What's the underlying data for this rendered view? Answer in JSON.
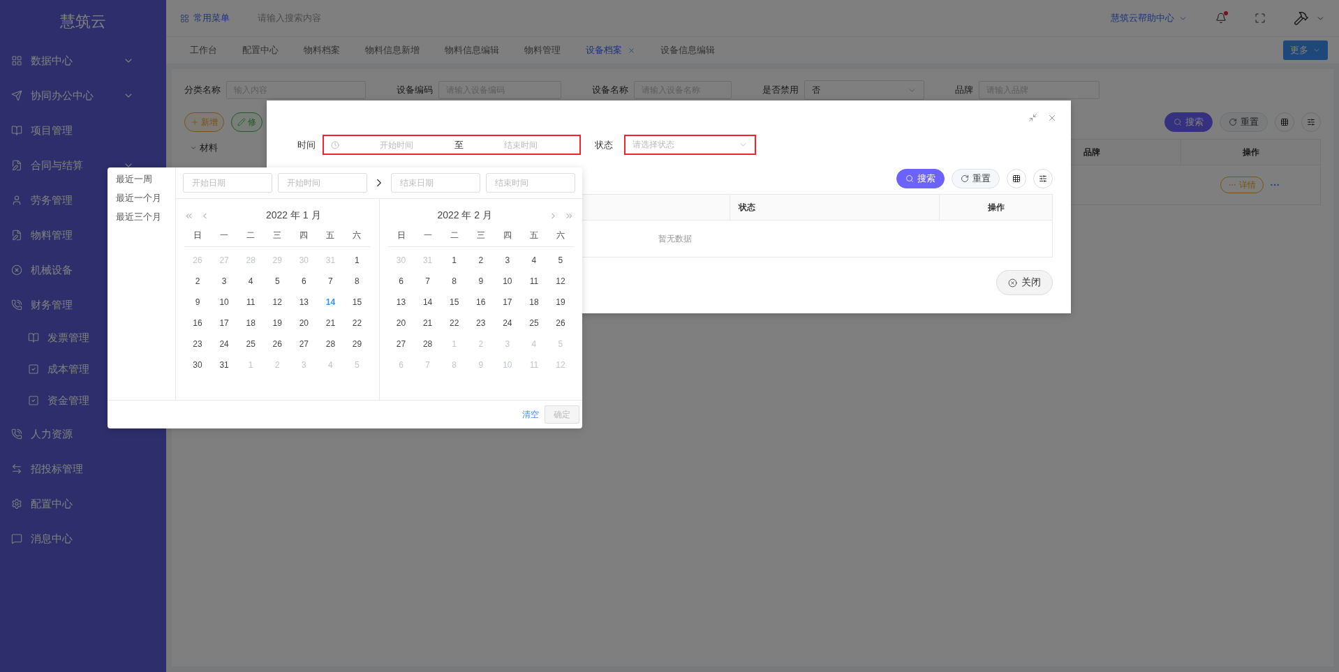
{
  "sidebar": {
    "logo": "慧筑云",
    "items": [
      {
        "label": "数据中心",
        "expanded": false
      },
      {
        "label": "协同办公中心",
        "expanded": false
      },
      {
        "label": "项目管理"
      },
      {
        "label": "合同与结算",
        "expanded": false
      },
      {
        "label": "劳务管理"
      },
      {
        "label": "物料管理"
      },
      {
        "label": "机械设备"
      },
      {
        "label": "财务管理",
        "children": [
          {
            "label": "发票管理"
          },
          {
            "label": "成本管理"
          },
          {
            "label": "资金管理"
          }
        ]
      },
      {
        "label": "人力资源"
      },
      {
        "label": "招投标管理"
      },
      {
        "label": "配置中心"
      },
      {
        "label": "消息中心"
      }
    ]
  },
  "topbar": {
    "menu": "常用菜单",
    "search_placeholder": "请输入搜索内容",
    "help": "慧筑云帮助中心",
    "has_notification": true
  },
  "tabs": [
    {
      "label": "工作台",
      "selected": false
    },
    {
      "label": "配置中心",
      "selected": false
    },
    {
      "label": "物料档案",
      "selected": false
    },
    {
      "label": "物料信息新增",
      "selected": false
    },
    {
      "label": "物料信息编辑",
      "selected": false
    },
    {
      "label": "物料管理",
      "selected": false
    },
    {
      "label": "设备档案",
      "selected": true,
      "closable": true
    },
    {
      "label": "设备信息编辑",
      "selected": false
    }
  ],
  "more_button": "更多",
  "filters": [
    {
      "label": "分类名称",
      "kind": "input",
      "placeholder": "输入内容"
    },
    {
      "label": "设备编码",
      "kind": "input",
      "placeholder": "请输入设备编码"
    },
    {
      "label": "设备名称",
      "kind": "input",
      "placeholder": "请输入设备名称"
    },
    {
      "label": "是否禁用",
      "kind": "select",
      "value": "否"
    },
    {
      "label": "品牌",
      "kind": "input",
      "placeholder": "请输入品牌"
    }
  ],
  "actions": [
    {
      "label": "新增",
      "kind": "add"
    },
    {
      "label": "修",
      "kind": "edit"
    }
  ],
  "tree": [
    {
      "label": "材料",
      "expanded": true
    }
  ],
  "page_toolbar": {
    "search": "搜索",
    "reset": "重置"
  },
  "page_table": {
    "columns": [
      "品牌",
      "操作"
    ],
    "row_action": "详情"
  },
  "dialog": {
    "time": {
      "label": "时间",
      "start_placeholder": "开始时间",
      "separator": "至",
      "end_placeholder": "结束时间",
      "highlighted": true
    },
    "status": {
      "label": "状态",
      "placeholder": "请选择状态",
      "highlighted": true
    },
    "search": "搜索",
    "reset": "重置",
    "columns": [
      "状态",
      "操作"
    ],
    "empty": "暂无数据",
    "close": "关闭"
  },
  "picker": {
    "presets": [
      "最近一周",
      "最近一个月",
      "最近三个月"
    ],
    "start_date_placeholder": "开始日期",
    "start_time_placeholder": "开始时间",
    "end_date_placeholder": "结束日期",
    "end_time_placeholder": "结束时间",
    "months": [
      {
        "title": "2022 年 1 月",
        "weekdays": [
          "日",
          "一",
          "二",
          "三",
          "四",
          "五",
          "六"
        ],
        "weeks": [
          [
            {
              "label": "26",
              "kind": "other"
            },
            {
              "label": "27",
              "kind": "other"
            },
            {
              "label": "28",
              "kind": "other"
            },
            {
              "label": "29",
              "kind": "other"
            },
            {
              "label": "30",
              "kind": "other"
            },
            {
              "label": "31",
              "kind": "other"
            },
            {
              "label": "1",
              "kind": "current"
            }
          ],
          [
            {
              "label": "2",
              "kind": "current"
            },
            {
              "label": "3",
              "kind": "current"
            },
            {
              "label": "4",
              "kind": "current"
            },
            {
              "label": "5",
              "kind": "current"
            },
            {
              "label": "6",
              "kind": "current"
            },
            {
              "label": "7",
              "kind": "current"
            },
            {
              "label": "8",
              "kind": "current"
            }
          ],
          [
            {
              "label": "9",
              "kind": "current"
            },
            {
              "label": "10",
              "kind": "current"
            },
            {
              "label": "11",
              "kind": "current"
            },
            {
              "label": "12",
              "kind": "current"
            },
            {
              "label": "13",
              "kind": "current"
            },
            {
              "label": "14",
              "kind": "today"
            },
            {
              "label": "15",
              "kind": "current"
            }
          ],
          [
            {
              "label": "16",
              "kind": "current"
            },
            {
              "label": "17",
              "kind": "current"
            },
            {
              "label": "18",
              "kind": "current"
            },
            {
              "label": "19",
              "kind": "current"
            },
            {
              "label": "20",
              "kind": "current"
            },
            {
              "label": "21",
              "kind": "current"
            },
            {
              "label": "22",
              "kind": "current"
            }
          ],
          [
            {
              "label": "23",
              "kind": "current"
            },
            {
              "label": "24",
              "kind": "current"
            },
            {
              "label": "25",
              "kind": "current"
            },
            {
              "label": "26",
              "kind": "current"
            },
            {
              "label": "27",
              "kind": "current"
            },
            {
              "label": "28",
              "kind": "current"
            },
            {
              "label": "29",
              "kind": "current"
            }
          ],
          [
            {
              "label": "30",
              "kind": "current"
            },
            {
              "label": "31",
              "kind": "current"
            },
            {
              "label": "1",
              "kind": "other"
            },
            {
              "label": "2",
              "kind": "other"
            },
            {
              "label": "3",
              "kind": "other"
            },
            {
              "label": "4",
              "kind": "other"
            },
            {
              "label": "5",
              "kind": "other"
            }
          ]
        ]
      },
      {
        "title": "2022 年 2 月",
        "weekdays": [
          "日",
          "一",
          "二",
          "三",
          "四",
          "五",
          "六"
        ],
        "weeks": [
          [
            {
              "label": "30",
              "kind": "other"
            },
            {
              "label": "31",
              "kind": "other"
            },
            {
              "label": "1",
              "kind": "current"
            },
            {
              "label": "2",
              "kind": "current"
            },
            {
              "label": "3",
              "kind": "current"
            },
            {
              "label": "4",
              "kind": "current"
            },
            {
              "label": "5",
              "kind": "current"
            }
          ],
          [
            {
              "label": "6",
              "kind": "current"
            },
            {
              "label": "7",
              "kind": "current"
            },
            {
              "label": "8",
              "kind": "current"
            },
            {
              "label": "9",
              "kind": "current"
            },
            {
              "label": "10",
              "kind": "current"
            },
            {
              "label": "11",
              "kind": "current"
            },
            {
              "label": "12",
              "kind": "current"
            }
          ],
          [
            {
              "label": "13",
              "kind": "current"
            },
            {
              "label": "14",
              "kind": "current"
            },
            {
              "label": "15",
              "kind": "current"
            },
            {
              "label": "16",
              "kind": "current"
            },
            {
              "label": "17",
              "kind": "current"
            },
            {
              "label": "18",
              "kind": "current"
            },
            {
              "label": "19",
              "kind": "current"
            }
          ],
          [
            {
              "label": "20",
              "kind": "current"
            },
            {
              "label": "21",
              "kind": "current"
            },
            {
              "label": "22",
              "kind": "current"
            },
            {
              "label": "23",
              "kind": "current"
            },
            {
              "label": "24",
              "kind": "current"
            },
            {
              "label": "25",
              "kind": "current"
            },
            {
              "label": "26",
              "kind": "current"
            }
          ],
          [
            {
              "label": "27",
              "kind": "current"
            },
            {
              "label": "28",
              "kind": "current"
            },
            {
              "label": "1",
              "kind": "other"
            },
            {
              "label": "2",
              "kind": "other"
            },
            {
              "label": "3",
              "kind": "other"
            },
            {
              "label": "4",
              "kind": "other"
            },
            {
              "label": "5",
              "kind": "other"
            }
          ],
          [
            {
              "label": "6",
              "kind": "other"
            },
            {
              "label": "7",
              "kind": "other"
            },
            {
              "label": "8",
              "kind": "other"
            },
            {
              "label": "9",
              "kind": "other"
            },
            {
              "label": "10",
              "kind": "other"
            },
            {
              "label": "11",
              "kind": "other"
            },
            {
              "label": "12",
              "kind": "other"
            }
          ]
        ]
      }
    ],
    "clear": "清空",
    "ok": {
      "label": "确定",
      "disabled": true
    }
  }
}
